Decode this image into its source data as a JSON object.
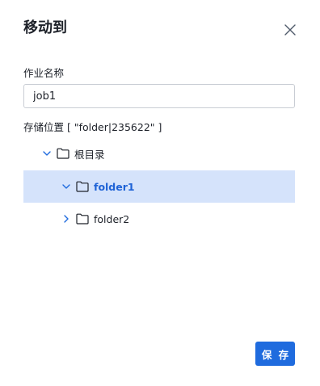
{
  "dialog": {
    "title": "移动到",
    "job_name_label": "作业名称",
    "job_name_value": "job1",
    "location_label": "存储位置 [ \"folder|235622\" ]",
    "save_label": "保 存"
  },
  "tree": {
    "root": {
      "label": "根目录",
      "expanded": true
    },
    "children": [
      {
        "label": "folder1",
        "expanded": true,
        "selected": true
      },
      {
        "label": "folder2",
        "expanded": false,
        "selected": false
      }
    ]
  },
  "colors": {
    "accent": "#1f6bde",
    "selected_bg": "#d5e3fb",
    "selected_text": "#1f63d6",
    "icon": "#1d2129"
  },
  "icons": {
    "close": "close-icon",
    "expanded": "chevron-down-icon",
    "collapsed": "chevron-right-icon",
    "folder": "folder-icon"
  }
}
